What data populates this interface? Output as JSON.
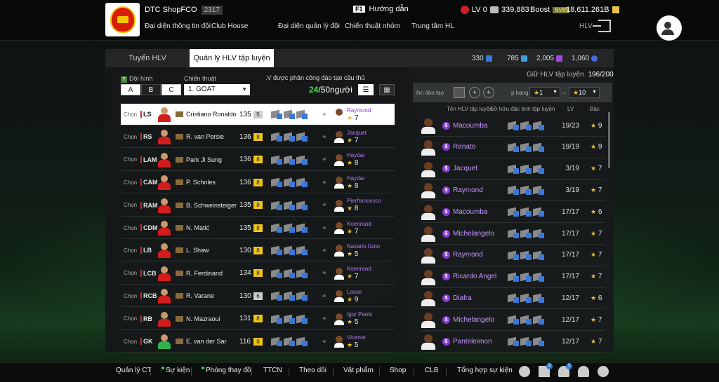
{
  "header": {
    "club_name": "DTC ShopFCO",
    "ovr": "2317",
    "nav": [
      "Đại diện thông tin đội",
      "Club House",
      "Đại diện quản lý đội",
      "Chiến thuật nhóm",
      "Trung tâm HL"
    ],
    "guide_key": "F1",
    "guide": "Hướng dẫn",
    "level": "LV 0",
    "points": "339,883",
    "boost": "Boost",
    "svip": "SVIP",
    "bp": "18,611.261B",
    "hlv": "HLV"
  },
  "tabs": {
    "left": "Tuyển HLV",
    "active": "Quản lý HLV tập luyện"
  },
  "resources": [
    {
      "value": "330",
      "color": "#3a78d8"
    },
    {
      "value": "785",
      "color": "#3aa0d8"
    },
    {
      "value": "2,005",
      "color": "#a04ad8"
    },
    {
      "value": "1,060",
      "color": "#4a6ad8"
    }
  ],
  "left": {
    "formation_label": "Đội hình",
    "formations": [
      "A",
      "B",
      "C"
    ],
    "tactic_label": "Chiến thuật",
    "tactic_value": "1. GOAT",
    "coach_info": ".V được phân công đào tạo cầu thủ",
    "count_value": "24",
    "count_total": "/50người"
  },
  "players": [
    {
      "chon": "Chọn",
      "pos": "LS",
      "name": "Cristiano Ronaldo",
      "ovr": "135",
      "lvl": "5",
      "coach": "Raymond",
      "stars": "7"
    },
    {
      "chon": "Chọn",
      "pos": "RS",
      "name": "R. van Persie",
      "ovr": "136",
      "lvl": "8",
      "coach": "Jacquet",
      "stars": "7"
    },
    {
      "chon": "Chọn",
      "pos": "LAM",
      "name": "Park Ji Sung",
      "ovr": "136",
      "lvl": "8",
      "coach": "Haydar",
      "stars": "8"
    },
    {
      "chon": "Chọn",
      "pos": "CAM",
      "name": "P. Scholes",
      "ovr": "136",
      "lvl": "8",
      "coach": "Haydar",
      "stars": "8"
    },
    {
      "chon": "Chọn",
      "pos": "RAM",
      "name": "B. Schweinsteiger",
      "ovr": "135",
      "lvl": "8",
      "coach": "Pierfrancesco",
      "stars": "8"
    },
    {
      "chon": "Chọn",
      "pos": "CDM",
      "name": "N. Matić",
      "ovr": "135",
      "lvl": "8",
      "coach": "Koenraad",
      "stars": "7"
    },
    {
      "chon": "Chọn",
      "pos": "LB",
      "name": "L. Shaw",
      "ovr": "130",
      "lvl": "8",
      "coach": "Nazario Guto",
      "stars": "5"
    },
    {
      "chon": "Chọn",
      "pos": "LCB",
      "name": "R. Ferdinand",
      "ovr": "134",
      "lvl": "8",
      "coach": "Koenraad",
      "stars": "7"
    },
    {
      "chon": "Chọn",
      "pos": "RCB",
      "name": "R. Varane",
      "ovr": "130",
      "lvl": "6",
      "coach": "Lasse",
      "stars": "9"
    },
    {
      "chon": "Chọn",
      "pos": "RB",
      "name": "N. Mazraoui",
      "ovr": "131",
      "lvl": "8",
      "coach": "Igor Paolo",
      "stars": "5"
    },
    {
      "chon": "Chọn",
      "pos": "GK",
      "name": "E. van der Sar",
      "ovr": "116",
      "lvl": "8",
      "coach": "Vicente",
      "stars": "5"
    }
  ],
  "right": {
    "giu_label": "Giữ HLV tập luyện",
    "giu_value": "196/200",
    "filter_label": "ểm đào tạo",
    "lv_label": "p hạng",
    "lv_min": "1",
    "lv_max": "10",
    "col_name": "Tên HLV tập luyện",
    "col_trait": "Sở hữu đặc tính tập luyện",
    "col_lv": "LV",
    "col_bac": "Bậc"
  },
  "coaches": [
    {
      "name": "Macoumba",
      "lv": "19/23",
      "bac": "9"
    },
    {
      "name": "Renato",
      "lv": "19/19",
      "bac": "9"
    },
    {
      "name": "Jacquet",
      "lv": "3/19",
      "bac": "7"
    },
    {
      "name": "Raymond",
      "lv": "3/19",
      "bac": "7"
    },
    {
      "name": "Macoumba",
      "lv": "17/17",
      "bac": "6"
    },
    {
      "name": "Michelangelo",
      "lv": "17/17",
      "bac": "7"
    },
    {
      "name": "Raymond",
      "lv": "17/17",
      "bac": "7"
    },
    {
      "name": "Ricardo Angel",
      "lv": "17/17",
      "bac": "7"
    },
    {
      "name": "Diafra",
      "lv": "12/17",
      "bac": "6"
    },
    {
      "name": "Michelangelo",
      "lv": "12/17",
      "bac": "7"
    },
    {
      "name": "Panteleimon",
      "lv": "12/17",
      "bac": "7"
    }
  ],
  "bottom": [
    "Quản lý CT",
    "Sự kiện",
    "Phòng thay đồ",
    "TTCN",
    "Theo dõi",
    "Vật phẩm",
    "Shop",
    "CLB",
    "Tổng hợp sự kiện"
  ],
  "badges": {
    "pen": "9",
    "bell": "3"
  }
}
